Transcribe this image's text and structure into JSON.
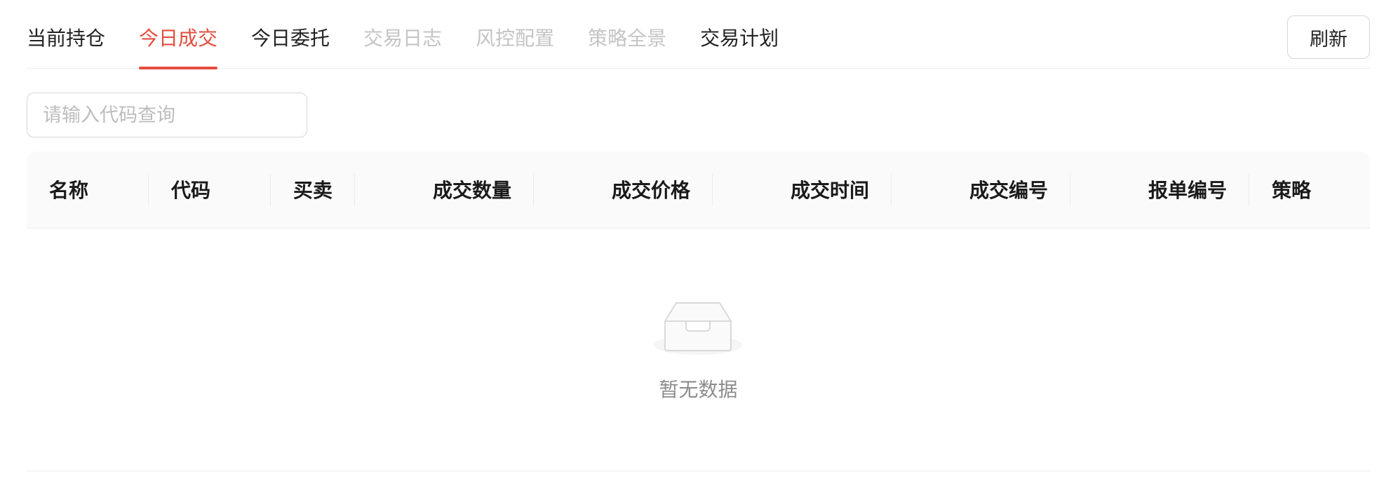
{
  "tabs": [
    {
      "label": "当前持仓",
      "state": "normal"
    },
    {
      "label": "今日成交",
      "state": "active"
    },
    {
      "label": "今日委托",
      "state": "normal"
    },
    {
      "label": "交易日志",
      "state": "disabled"
    },
    {
      "label": "风控配置",
      "state": "disabled"
    },
    {
      "label": "策略全景",
      "state": "disabled"
    },
    {
      "label": "交易计划",
      "state": "normal"
    }
  ],
  "toolbar": {
    "refresh_label": "刷新"
  },
  "search": {
    "placeholder": "请输入代码查询",
    "value": ""
  },
  "table": {
    "columns": [
      "名称",
      "代码",
      "买卖",
      "成交数量",
      "成交价格",
      "成交时间",
      "成交编号",
      "报单编号",
      "策略"
    ],
    "rows": []
  },
  "empty": {
    "icon": "empty-inbox-icon",
    "text": "暂无数据"
  },
  "colors": {
    "accent": "#e34d3f",
    "disabled_text": "#c4c4c4",
    "header_bg": "#fafafa",
    "border": "#ececec"
  }
}
